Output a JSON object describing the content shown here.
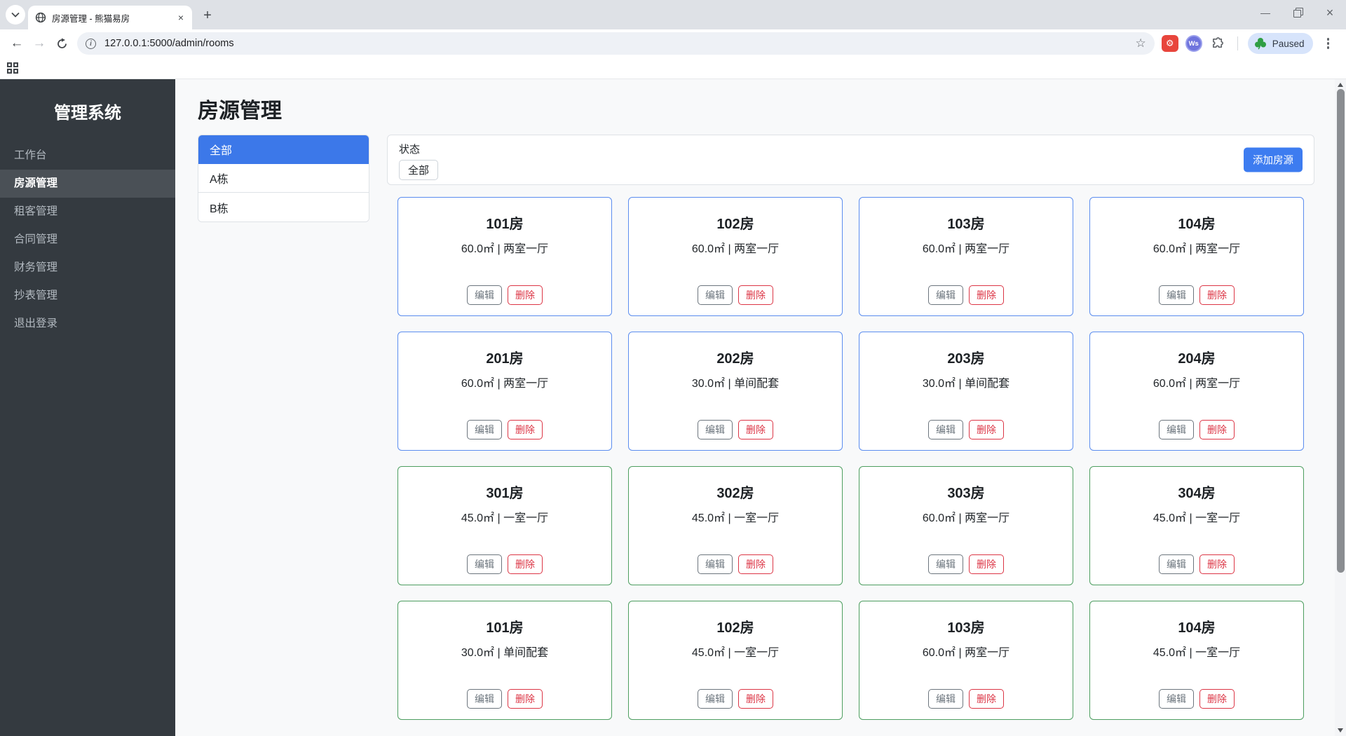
{
  "browser": {
    "tab_title": "房源管理 - 熊猫易房",
    "new_tab_label": "+",
    "url": "127.0.0.1:5000/admin/rooms",
    "ws_badge_text": "Ws",
    "paused_label": "Paused"
  },
  "icons": {
    "tab_favicon": "globe-icon",
    "omnibox_left": "info-icon",
    "omnibox_right": "star-icon",
    "extension_1": "gear-extension-icon",
    "extension_2": "ws-extension-icon",
    "extension_3": "puzzle-extensions-icon",
    "paused_badge": "clover-icon",
    "bookmarks_bar": "apps-grid-icon"
  },
  "sidebar": {
    "title": "管理系统",
    "items": [
      {
        "label": "工作台",
        "active": false
      },
      {
        "label": "房源管理",
        "active": true
      },
      {
        "label": "租客管理",
        "active": false
      },
      {
        "label": "合同管理",
        "active": false
      },
      {
        "label": "财务管理",
        "active": false
      },
      {
        "label": "抄表管理",
        "active": false
      },
      {
        "label": "退出登录",
        "active": false
      }
    ]
  },
  "main": {
    "page_title": "房源管理",
    "buildings": [
      {
        "label": "全部",
        "active": true
      },
      {
        "label": "A栋",
        "active": false
      },
      {
        "label": "B栋",
        "active": false
      }
    ],
    "status_filter": {
      "label": "状态",
      "selected": "全部"
    },
    "add_room_label": "添加房源",
    "actions": {
      "edit": "编辑",
      "delete": "删除"
    },
    "rooms": [
      {
        "name": "101房",
        "info": "60.0㎡ | 两室一厅",
        "status": "blue"
      },
      {
        "name": "102房",
        "info": "60.0㎡ | 两室一厅",
        "status": "blue"
      },
      {
        "name": "103房",
        "info": "60.0㎡ | 两室一厅",
        "status": "blue"
      },
      {
        "name": "104房",
        "info": "60.0㎡ | 两室一厅",
        "status": "blue"
      },
      {
        "name": "201房",
        "info": "60.0㎡ | 两室一厅",
        "status": "blue"
      },
      {
        "name": "202房",
        "info": "30.0㎡ | 单间配套",
        "status": "blue"
      },
      {
        "name": "203房",
        "info": "30.0㎡ | 单间配套",
        "status": "blue"
      },
      {
        "name": "204房",
        "info": "60.0㎡ | 两室一厅",
        "status": "blue"
      },
      {
        "name": "301房",
        "info": "45.0㎡ | 一室一厅",
        "status": "green"
      },
      {
        "name": "302房",
        "info": "45.0㎡ | 一室一厅",
        "status": "green"
      },
      {
        "name": "303房",
        "info": "60.0㎡ | 两室一厅",
        "status": "green"
      },
      {
        "name": "304房",
        "info": "45.0㎡ | 一室一厅",
        "status": "green"
      },
      {
        "name": "101房",
        "info": "30.0㎡ | 单间配套",
        "status": "green"
      },
      {
        "name": "102房",
        "info": "45.0㎡ | 一室一厅",
        "status": "green"
      },
      {
        "name": "103房",
        "info": "60.0㎡ | 两室一厅",
        "status": "green"
      },
      {
        "name": "104房",
        "info": "45.0㎡ | 一室一厅",
        "status": "green"
      }
    ]
  },
  "colors": {
    "primary_blue": "#3c78e9",
    "card_border_blue": "#5b8def",
    "card_border_green": "#4d9e60",
    "danger_red": "#dc3545",
    "secondary_gray": "#6c757d",
    "sidebar_bg": "#343a40",
    "page_bg": "#f8f9fa",
    "tab_strip_bg": "#dee1e6"
  }
}
